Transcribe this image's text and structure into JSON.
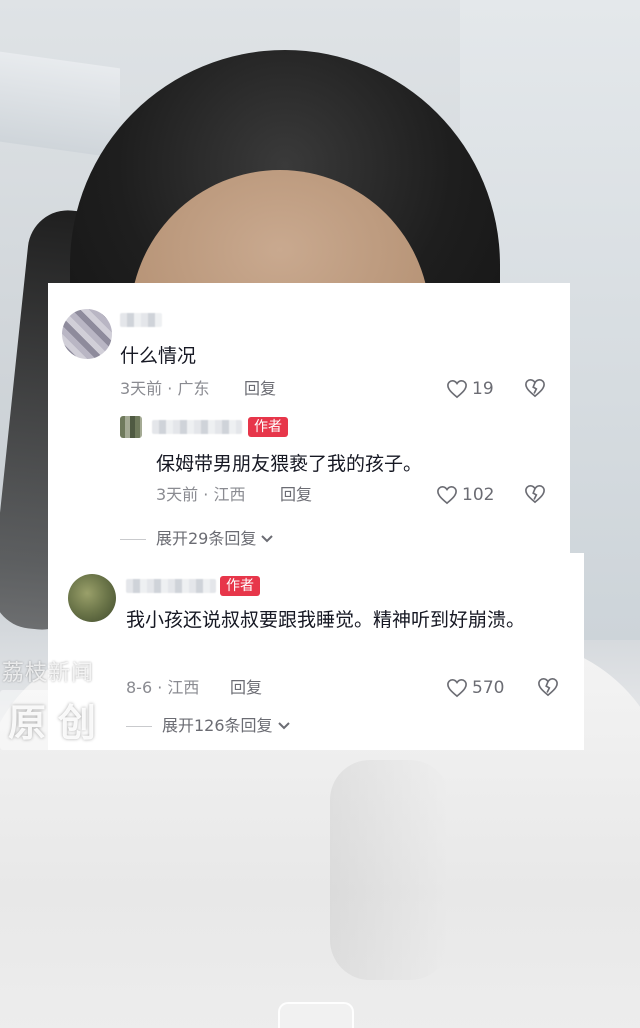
{
  "watermark": {
    "brand": "荔枝新闻",
    "label": "原创"
  },
  "comments": [
    {
      "text": "什么情况",
      "meta": "3天前 · 广东",
      "reply_label": "回复",
      "likes": "19",
      "expand": "展开29条回复"
    },
    {
      "author_tag": "作者",
      "text": "保姆带男朋友猥亵了我的孩子。",
      "meta": "3天前 · 江西",
      "reply_label": "回复",
      "likes": "102"
    },
    {
      "author_tag": "作者",
      "text": "我小孩还说叔叔要跟我睡觉。精神听到好崩溃。",
      "meta": "8-6 · 江西",
      "reply_label": "回复",
      "likes": "570",
      "expand": "展开126条回复"
    }
  ],
  "icons": {
    "like": "heart-outline-icon",
    "dislike": "broken-heart-icon",
    "expand": "chevron-down-icon"
  },
  "colors": {
    "author_tag_bg": "#e7364a",
    "text": "#161823",
    "meta": "#8a8b91"
  }
}
